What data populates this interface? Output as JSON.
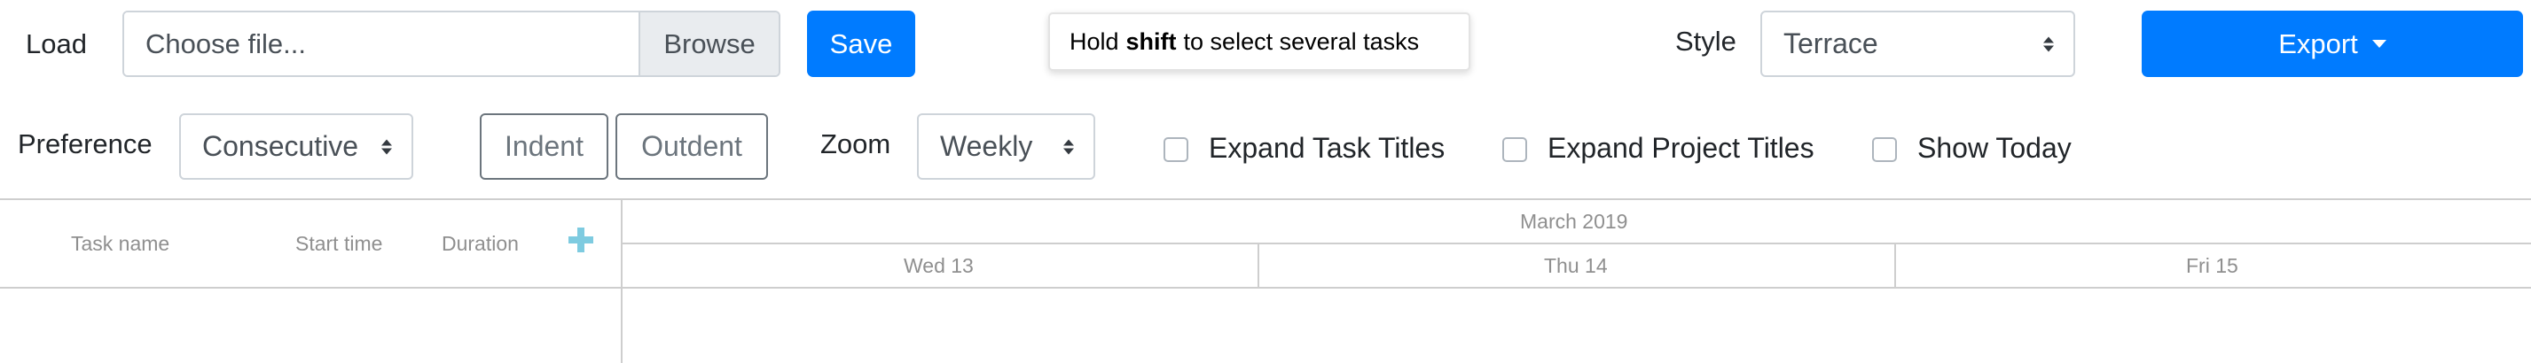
{
  "toolbar": {
    "load_label": "Load",
    "file_placeholder": "Choose file...",
    "browse_label": "Browse",
    "save_label": "Save",
    "hint_prefix": "Hold",
    "hint_key": "shift",
    "hint_suffix": "to select several tasks",
    "style_label": "Style",
    "style_value": "Terrace",
    "export_label": "Export",
    "preference_label": "Preference",
    "preference_value": "Consecutive",
    "indent_label": "Indent",
    "outdent_label": "Outdent",
    "zoom_label": "Zoom",
    "zoom_value": "Weekly",
    "expand_task_titles": "Expand Task Titles",
    "expand_project_titles": "Expand Project Titles",
    "show_today": "Show Today"
  },
  "grid": {
    "columns": [
      "Task name",
      "Start time",
      "Duration"
    ],
    "add_symbol": "+"
  },
  "timeline": {
    "month": "March 2019",
    "days": [
      "Wed 13",
      "Thu 14",
      "Fri 15"
    ]
  },
  "colors": {
    "primary": "#007bff",
    "add_icon": "#7ecbe0",
    "grid_line": "#cecece"
  }
}
